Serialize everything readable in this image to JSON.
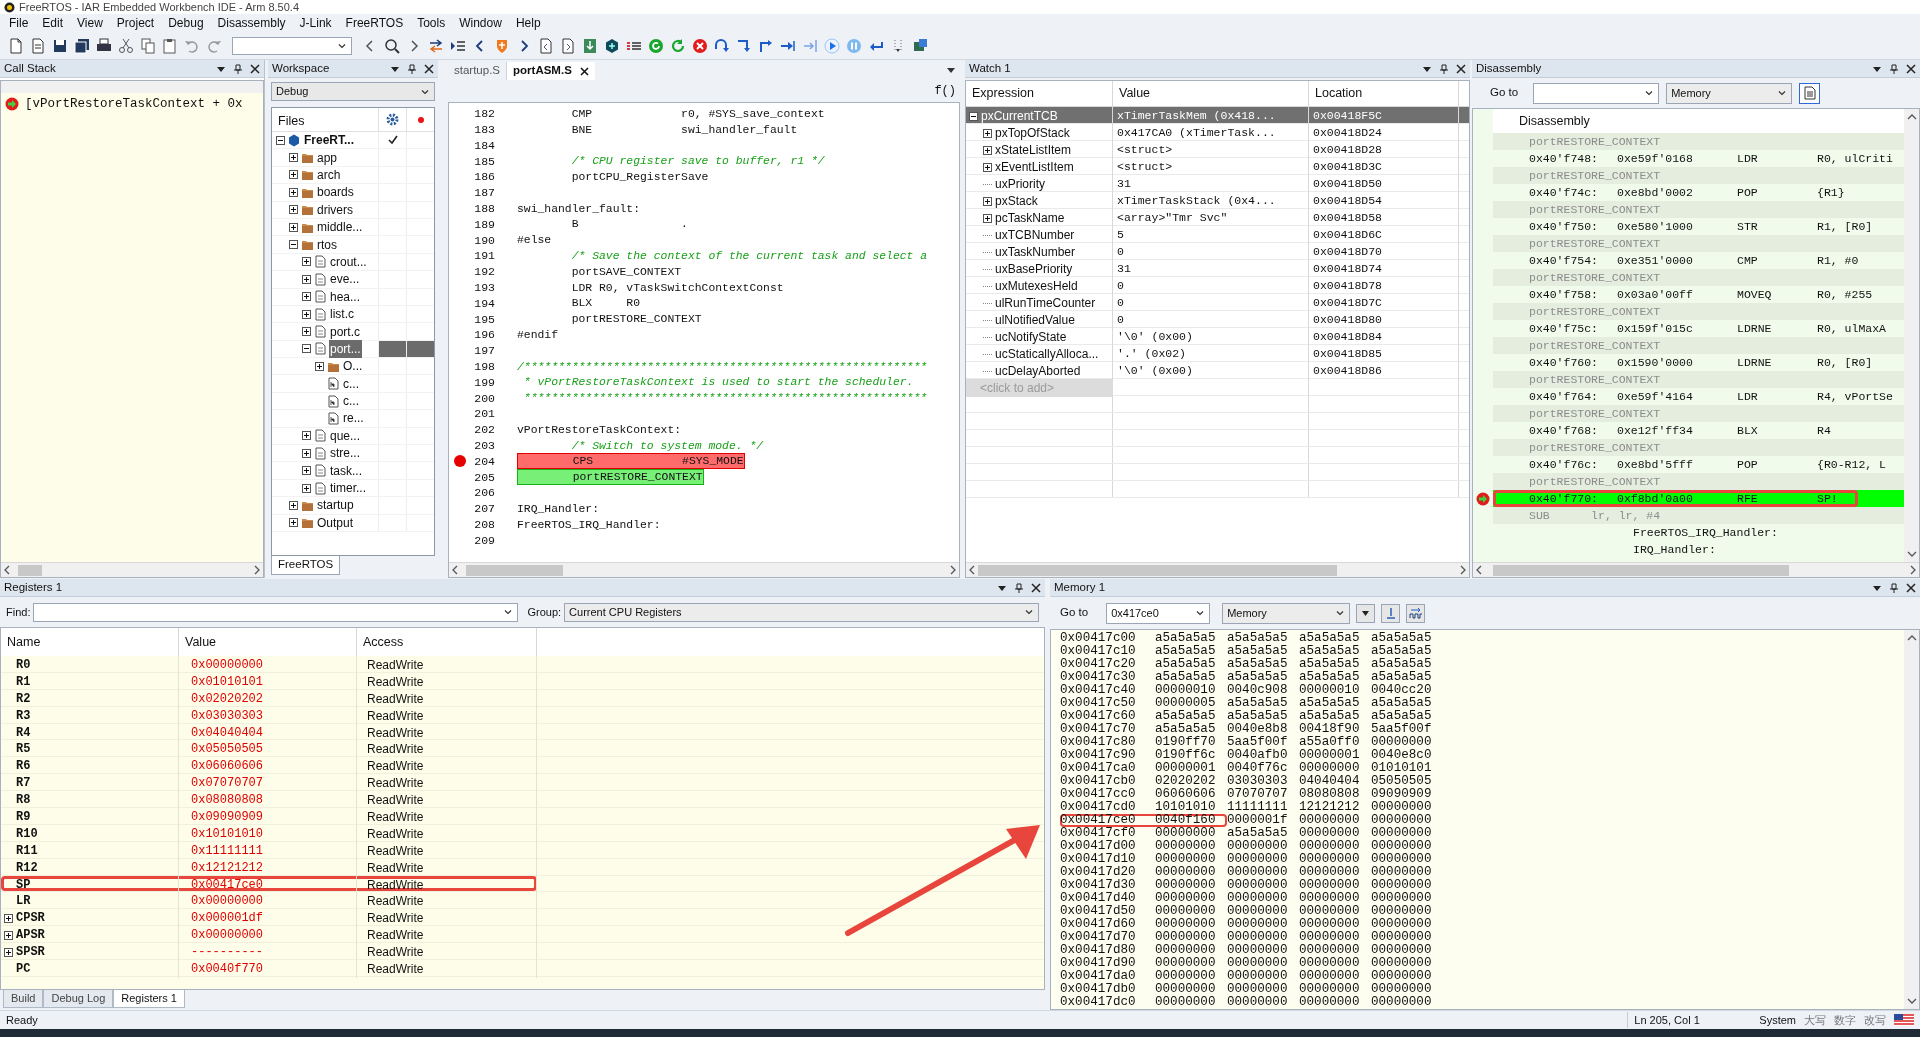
{
  "window": {
    "title": "FreeRTOS - IAR Embedded Workbench IDE - Arm 8.50.4"
  },
  "menu": [
    "File",
    "Edit",
    "View",
    "Project",
    "Debug",
    "Disassembly",
    "J-Link",
    "FreeRTOS",
    "Tools",
    "Window",
    "Help"
  ],
  "call_stack": {
    "title": "Call Stack",
    "frames": [
      {
        "text": "[vPortRestoreTaskContext + 0x",
        "current": true
      }
    ]
  },
  "workspace": {
    "title": "Workspace",
    "configuration": "Debug",
    "files_header": "Files",
    "tabs": [
      {
        "label": "FreeRTOS",
        "selected": true
      }
    ],
    "tree": [
      {
        "label": "FreeRT...",
        "kind": "project",
        "expanded": true,
        "selected": false,
        "checked": true,
        "children": [
          {
            "label": "app",
            "kind": "folder",
            "expanded": false,
            "selected": false
          },
          {
            "label": "arch",
            "kind": "folder",
            "expanded": false,
            "selected": false
          },
          {
            "label": "boards",
            "kind": "folder",
            "expanded": false,
            "selected": false
          },
          {
            "label": "drivers",
            "kind": "folder",
            "expanded": false,
            "selected": false
          },
          {
            "label": "middle...",
            "kind": "folder",
            "expanded": false,
            "selected": false
          },
          {
            "label": "rtos",
            "kind": "folder",
            "expanded": true,
            "selected": false,
            "children": [
              {
                "label": "crout...",
                "kind": "source",
                "expanded": false,
                "selected": false
              },
              {
                "label": "eve...",
                "kind": "source",
                "expanded": false,
                "selected": false
              },
              {
                "label": "hea...",
                "kind": "source",
                "expanded": false,
                "selected": false
              },
              {
                "label": "list.c",
                "kind": "source",
                "expanded": false,
                "selected": false
              },
              {
                "label": "port.c",
                "kind": "source",
                "expanded": false,
                "selected": false
              },
              {
                "label": "port...",
                "kind": "source",
                "expanded": true,
                "selected": true,
                "children": [
                  {
                    "label": "O...",
                    "kind": "folder",
                    "expanded": false,
                    "selected": false
                  },
                  {
                    "label": "c...",
                    "kind": "header",
                    "selected": false
                  },
                  {
                    "label": "c...",
                    "kind": "header",
                    "selected": false
                  },
                  {
                    "label": "re...",
                    "kind": "header",
                    "selected": false
                  }
                ]
              },
              {
                "label": "que...",
                "kind": "source",
                "expanded": false,
                "selected": false
              },
              {
                "label": "stre...",
                "kind": "source",
                "expanded": false,
                "selected": false
              },
              {
                "label": "task...",
                "kind": "source",
                "expanded": false,
                "selected": false
              },
              {
                "label": "timer...",
                "kind": "source",
                "expanded": false,
                "selected": false
              }
            ]
          },
          {
            "label": "startup",
            "kind": "folder",
            "expanded": false,
            "selected": false
          },
          {
            "label": "Output",
            "kind": "folder",
            "expanded": false,
            "selected": false
          }
        ]
      }
    ]
  },
  "editor": {
    "tabs": [
      {
        "label": "startup.S",
        "selected": false
      },
      {
        "label": "portASM.S",
        "selected": true
      }
    ],
    "function_button": "f()",
    "lines": [
      {
        "number": "182",
        "kind": "code",
        "text": "        CMP             r0, #SYS_save_context"
      },
      {
        "number": "183",
        "kind": "code",
        "text": "        BNE             swi_handler_fault"
      },
      {
        "number": "184"
      },
      {
        "number": "185",
        "kind": "comment",
        "text": "        /* CPU register save to buffer, r1 */"
      },
      {
        "number": "186",
        "kind": "code",
        "text": "        portCPU_RegisterSave"
      },
      {
        "number": "187"
      },
      {
        "number": "188",
        "kind": "code",
        "text": "swi_handler_fault:"
      },
      {
        "number": "189",
        "kind": "code",
        "text": "        B               ."
      },
      {
        "number": "190",
        "kind": "code",
        "text": "#else"
      },
      {
        "number": "191",
        "kind": "comment",
        "text": "        /* Save the context of the current task and select a"
      },
      {
        "number": "192",
        "kind": "code",
        "text": "        portSAVE_CONTEXT"
      },
      {
        "number": "193",
        "kind": "code",
        "text": "        LDR R0, vTaskSwitchContextConst"
      },
      {
        "number": "194",
        "kind": "code",
        "text": "        BLX     R0"
      },
      {
        "number": "195",
        "kind": "code",
        "text": "        portRESTORE_CONTEXT"
      },
      {
        "number": "196",
        "kind": "code",
        "text": "#endif"
      },
      {
        "number": "197"
      },
      {
        "number": "198",
        "kind": "comment",
        "text": "/***********************************************************"
      },
      {
        "number": "199",
        "kind": "comment",
        "text": " * vPortRestoreTaskContext is used to start the scheduler."
      },
      {
        "number": "200",
        "kind": "comment",
        "text": " ***********************************************************"
      },
      {
        "number": "201"
      },
      {
        "number": "202",
        "kind": "code",
        "text": "vPortRestoreTaskContext:"
      },
      {
        "number": "203",
        "kind": "comment",
        "text": "        /* Switch to system mode. */"
      },
      {
        "number": "204",
        "kind": "code",
        "text": "        CPS             #SYS_MODE",
        "breakpoint": true
      },
      {
        "number": "205",
        "kind": "code",
        "text": "        portRESTORE_CONTEXT",
        "current": true
      },
      {
        "number": "206"
      },
      {
        "number": "207",
        "kind": "code",
        "text": "IRQ_Handler:"
      },
      {
        "number": "208",
        "kind": "code",
        "text": "FreeRTOS_IRQ_Handler:"
      },
      {
        "number": "209"
      }
    ]
  },
  "watch": {
    "title": "Watch 1",
    "columns": [
      "Expression",
      "Value",
      "Location"
    ],
    "add_hint": "<click to add>",
    "rows": [
      {
        "expression": "pxCurrentTCB",
        "value": "xTimerTaskMem (0x418...",
        "location": "0x00418F5C",
        "expanded": true,
        "selected": true,
        "children": [
          {
            "expression": "pxTopOfStack",
            "value": "0x417CA0 (xTimerTask...",
            "location": "0x00418D24",
            "expanded": false,
            "selected": false
          },
          {
            "expression": "xStateListItem",
            "value": "<struct>",
            "location": "0x00418D28",
            "expanded": false,
            "selected": false
          },
          {
            "expression": "xEventListItem",
            "value": "<struct>",
            "location": "0x00418D3C",
            "expanded": false,
            "selected": false
          },
          {
            "expression": "uxPriority",
            "value": "31",
            "location": "0x00418D50",
            "selected": false
          },
          {
            "expression": "pxStack",
            "value": "xTimerTaskStack (0x4...",
            "location": "0x00418D54",
            "expanded": false,
            "selected": false
          },
          {
            "expression": "pcTaskName",
            "value": "<array>\"Tmr Svc\"",
            "location": "0x00418D58",
            "expanded": false,
            "selected": false
          },
          {
            "expression": "uxTCBNumber",
            "value": "5",
            "location": "0x00418D6C",
            "selected": false
          },
          {
            "expression": "uxTaskNumber",
            "value": "0",
            "location": "0x00418D70",
            "selected": false
          },
          {
            "expression": "uxBasePriority",
            "value": "31",
            "location": "0x00418D74",
            "selected": false
          },
          {
            "expression": "uxMutexesHeld",
            "value": "0",
            "location": "0x00418D78",
            "selected": false
          },
          {
            "expression": "ulRunTimeCounter",
            "value": "0",
            "location": "0x00418D7C",
            "selected": false
          },
          {
            "expression": "ulNotifiedValue",
            "value": "0",
            "location": "0x00418D80",
            "selected": false
          },
          {
            "expression": "ucNotifyState",
            "value": "'\\0' (0x00)",
            "location": "0x00418D84",
            "selected": false
          },
          {
            "expression": "ucStaticallyAlloca...",
            "value": "'.' (0x02)",
            "location": "0x00418D85",
            "selected": false
          },
          {
            "expression": "ucDelayAborted",
            "value": "'\\0' (0x00)",
            "location": "0x00418D86",
            "selected": false
          }
        ]
      }
    ]
  },
  "disassembly": {
    "title": "Disassembly",
    "goto_label": "Go to",
    "zone": "Memory",
    "heading": "Disassembly",
    "rows": [
      {
        "kind": "source",
        "text": "portRESTORE_CONTEXT"
      },
      {
        "kind": "instruction",
        "address": "0x40'f748:",
        "code": "0xe59f'0168",
        "mnemonic": "LDR",
        "operands": "R0, ulCriti"
      },
      {
        "kind": "source",
        "text": "portRESTORE_CONTEXT"
      },
      {
        "kind": "instruction",
        "address": "0x40'f74c:",
        "code": "0xe8bd'0002",
        "mnemonic": "POP",
        "operands": "{R1}"
      },
      {
        "kind": "source",
        "text": "portRESTORE_CONTEXT"
      },
      {
        "kind": "instruction",
        "address": "0x40'f750:",
        "code": "0xe580'1000",
        "mnemonic": "STR",
        "operands": "R1, [R0]"
      },
      {
        "kind": "source",
        "text": "portRESTORE_CONTEXT"
      },
      {
        "kind": "instruction",
        "address": "0x40'f754:",
        "code": "0xe351'0000",
        "mnemonic": "CMP",
        "operands": "R1, #0"
      },
      {
        "kind": "source",
        "text": "portRESTORE_CONTEXT"
      },
      {
        "kind": "instruction",
        "address": "0x40'f758:",
        "code": "0x03a0'00ff",
        "mnemonic": "MOVEQ",
        "operands": "R0, #255"
      },
      {
        "kind": "source",
        "text": "portRESTORE_CONTEXT"
      },
      {
        "kind": "instruction",
        "address": "0x40'f75c:",
        "code": "0x159f'015c",
        "mnemonic": "LDRNE",
        "operands": "R0, ulMaxA"
      },
      {
        "kind": "source",
        "text": "portRESTORE_CONTEXT"
      },
      {
        "kind": "instruction",
        "address": "0x40'f760:",
        "code": "0x1590'0000",
        "mnemonic": "LDRNE",
        "operands": "R0, [R0]"
      },
      {
        "kind": "source",
        "text": "portRESTORE_CONTEXT"
      },
      {
        "kind": "instruction",
        "address": "0x40'f764:",
        "code": "0xe59f'4164",
        "mnemonic": "LDR",
        "operands": "R4, vPortSe"
      },
      {
        "kind": "source",
        "text": "portRESTORE_CONTEXT"
      },
      {
        "kind": "instruction",
        "address": "0x40'f768:",
        "code": "0xe12f'ff34",
        "mnemonic": "BLX",
        "operands": "R4"
      },
      {
        "kind": "source",
        "text": "portRESTORE_CONTEXT"
      },
      {
        "kind": "instruction",
        "address": "0x40'f76c:",
        "code": "0xe8bd'5fff",
        "mnemonic": "POP",
        "operands": "{R0-R12, L"
      },
      {
        "kind": "source",
        "text": "portRESTORE_CONTEXT"
      },
      {
        "kind": "instruction",
        "address": "0x40'f770:",
        "code": "0xf8bd'0a00",
        "mnemonic": "RFE",
        "operands": "SP!",
        "current": true,
        "annotated": true
      },
      {
        "kind": "source",
        "text": "SUB      lr, lr, #4"
      },
      {
        "kind": "label",
        "text": "FreeRTOS_IRQ_Handler:"
      },
      {
        "kind": "label",
        "text": "IRQ_Handler:"
      }
    ]
  },
  "registers": {
    "title": "Registers 1",
    "find_label": "Find:",
    "group_label": "Group:",
    "group": "Current CPU Registers",
    "columns": [
      "Name",
      "Value",
      "Access"
    ],
    "rows": [
      {
        "name": "R0",
        "value": "0x00000000",
        "access": "ReadWrite"
      },
      {
        "name": "R1",
        "value": "0x01010101",
        "access": "ReadWrite"
      },
      {
        "name": "R2",
        "value": "0x02020202",
        "access": "ReadWrite"
      },
      {
        "name": "R3",
        "value": "0x03030303",
        "access": "ReadWrite"
      },
      {
        "name": "R4",
        "value": "0x04040404",
        "access": "ReadWrite"
      },
      {
        "name": "R5",
        "value": "0x05050505",
        "access": "ReadWrite"
      },
      {
        "name": "R6",
        "value": "0x06060606",
        "access": "ReadWrite"
      },
      {
        "name": "R7",
        "value": "0x07070707",
        "access": "ReadWrite"
      },
      {
        "name": "R8",
        "value": "0x08080808",
        "access": "ReadWrite"
      },
      {
        "name": "R9",
        "value": "0x09090909",
        "access": "ReadWrite"
      },
      {
        "name": "R10",
        "value": "0x10101010",
        "access": "ReadWrite"
      },
      {
        "name": "R11",
        "value": "0x11111111",
        "access": "ReadWrite"
      },
      {
        "name": "R12",
        "value": "0x12121212",
        "access": "ReadWrite"
      },
      {
        "name": "SP",
        "value": "0x00417ce0",
        "access": "ReadWrite",
        "annotated": true
      },
      {
        "name": "LR",
        "value": "0x00000000",
        "access": "ReadWrite"
      },
      {
        "name": "CPSR",
        "value": "0x000001df",
        "access": "ReadWrite",
        "expanded": false
      },
      {
        "name": "APSR",
        "value": "0x00000000",
        "access": "ReadWrite",
        "expanded": false
      },
      {
        "name": "SPSR",
        "value": "----------",
        "access": "ReadWrite",
        "expanded": false
      },
      {
        "name": "PC",
        "value": "0x0040f770",
        "access": "ReadWrite"
      }
    ],
    "tabs": [
      {
        "label": "Build",
        "selected": false
      },
      {
        "label": "Debug Log",
        "selected": false
      },
      {
        "label": "Registers 1",
        "selected": true
      }
    ]
  },
  "memory": {
    "title": "Memory 1",
    "goto_label": "Go to",
    "goto": "0x417ce0",
    "zone": "Memory",
    "rows": [
      {
        "address": "0x00417c00",
        "words": [
          "a5a5a5a5",
          "a5a5a5a5",
          "a5a5a5a5",
          "a5a5a5a5"
        ]
      },
      {
        "address": "0x00417c10",
        "words": [
          "a5a5a5a5",
          "a5a5a5a5",
          "a5a5a5a5",
          "a5a5a5a5"
        ]
      },
      {
        "address": "0x00417c20",
        "words": [
          "a5a5a5a5",
          "a5a5a5a5",
          "a5a5a5a5",
          "a5a5a5a5"
        ]
      },
      {
        "address": "0x00417c30",
        "words": [
          "a5a5a5a5",
          "a5a5a5a5",
          "a5a5a5a5",
          "a5a5a5a5"
        ]
      },
      {
        "address": "0x00417c40",
        "words": [
          "00000010",
          "0040c908",
          "00000010",
          "0040cc20"
        ]
      },
      {
        "address": "0x00417c50",
        "words": [
          "00000005",
          "a5a5a5a5",
          "a5a5a5a5",
          "a5a5a5a5"
        ]
      },
      {
        "address": "0x00417c60",
        "words": [
          "a5a5a5a5",
          "a5a5a5a5",
          "a5a5a5a5",
          "a5a5a5a5"
        ]
      },
      {
        "address": "0x00417c70",
        "words": [
          "a5a5a5a5",
          "0040e8b8",
          "00418f90",
          "5aa5f00f"
        ]
      },
      {
        "address": "0x00417c80",
        "words": [
          "0190ff70",
          "5aa5f00f",
          "a55a0ff0",
          "00000000"
        ]
      },
      {
        "address": "0x00417c90",
        "words": [
          "0190ff6c",
          "0040afb0",
          "00000001",
          "0040e8c0"
        ]
      },
      {
        "address": "0x00417ca0",
        "words": [
          "00000001",
          "0040f76c",
          "00000000",
          "01010101"
        ]
      },
      {
        "address": "0x00417cb0",
        "words": [
          "02020202",
          "03030303",
          "04040404",
          "05050505"
        ]
      },
      {
        "address": "0x00417cc0",
        "words": [
          "06060606",
          "07070707",
          "08080808",
          "09090909"
        ]
      },
      {
        "address": "0x00417cd0",
        "words": [
          "10101010",
          "11111111",
          "12121212",
          "00000000"
        ]
      },
      {
        "address": "0x00417ce0",
        "words": [
          "0040f160",
          "0000001f",
          "00000000",
          "00000000"
        ],
        "annotated": true
      },
      {
        "address": "0x00417cf0",
        "words": [
          "00000000",
          "a5a5a5a5",
          "00000000",
          "00000000"
        ]
      },
      {
        "address": "0x00417d00",
        "words": [
          "00000000",
          "00000000",
          "00000000",
          "00000000"
        ]
      },
      {
        "address": "0x00417d10",
        "words": [
          "00000000",
          "00000000",
          "00000000",
          "00000000"
        ]
      },
      {
        "address": "0x00417d20",
        "words": [
          "00000000",
          "00000000",
          "00000000",
          "00000000"
        ]
      },
      {
        "address": "0x00417d30",
        "words": [
          "00000000",
          "00000000",
          "00000000",
          "00000000"
        ]
      },
      {
        "address": "0x00417d40",
        "words": [
          "00000000",
          "00000000",
          "00000000",
          "00000000"
        ]
      },
      {
        "address": "0x00417d50",
        "words": [
          "00000000",
          "00000000",
          "00000000",
          "00000000"
        ]
      },
      {
        "address": "0x00417d60",
        "words": [
          "00000000",
          "00000000",
          "00000000",
          "00000000"
        ]
      },
      {
        "address": "0x00417d70",
        "words": [
          "00000000",
          "00000000",
          "00000000",
          "00000000"
        ]
      },
      {
        "address": "0x00417d80",
        "words": [
          "00000000",
          "00000000",
          "00000000",
          "00000000"
        ]
      },
      {
        "address": "0x00417d90",
        "words": [
          "00000000",
          "00000000",
          "00000000",
          "00000000"
        ]
      },
      {
        "address": "0x00417da0",
        "words": [
          "00000000",
          "00000000",
          "00000000",
          "00000000"
        ]
      },
      {
        "address": "0x00417db0",
        "words": [
          "00000000",
          "00000000",
          "00000000",
          "00000000"
        ]
      },
      {
        "address": "0x00417dc0",
        "words": [
          "00000000",
          "00000000",
          "00000000",
          "00000000"
        ]
      }
    ]
  },
  "status_bar": {
    "text": "Ready",
    "position": "Ln 205, Col 1",
    "mode": "System",
    "indicators": [
      "大写",
      "数字",
      "改写"
    ]
  }
}
